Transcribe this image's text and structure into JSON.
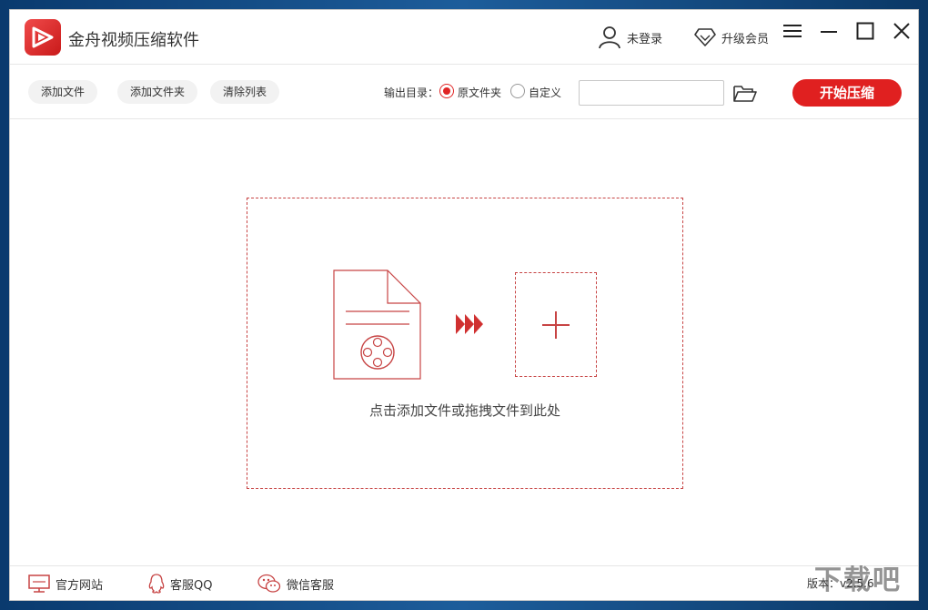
{
  "app": {
    "title": "金舟视频压缩软件"
  },
  "titlebar": {
    "login_label": "未登录",
    "vip_label": "升级会员"
  },
  "toolbar": {
    "add_file_label": "添加文件",
    "add_folder_label": "添加文件夹",
    "clear_list_label": "清除列表",
    "output_dir_label": "输出目录：",
    "option_original_label": "原文件夹",
    "option_custom_label": "自定义",
    "selected_option": "原文件夹",
    "path_value": "",
    "start_label": "开始压缩"
  },
  "dropzone": {
    "hint": "点击添加文件或拖拽文件到此处"
  },
  "footer": {
    "website_label": "官方网站",
    "qq_label": "客服QQ",
    "wechat_label": "微信客服",
    "version": "版本：v2.5.6"
  },
  "watermark": {
    "text": "下载吧"
  },
  "colors": {
    "accent": "#e02020",
    "dash": "#c74444"
  }
}
